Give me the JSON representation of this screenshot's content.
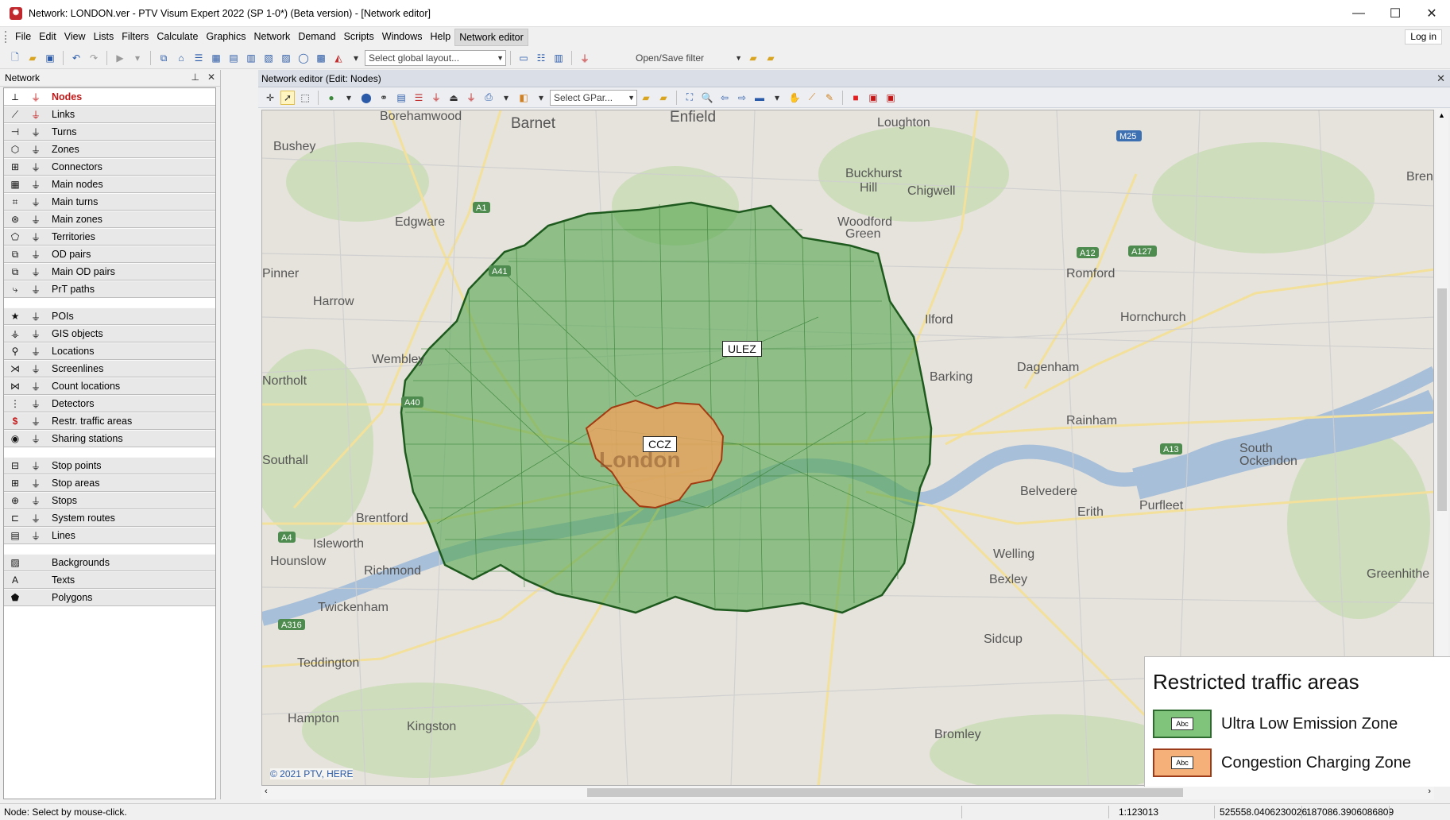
{
  "window": {
    "title": "Network: LONDON.ver - PTV Visum Expert 2022 (SP 1-0*) (Beta version) - [Network editor]",
    "minimize": "—",
    "maximize": "☐",
    "close": "✕"
  },
  "menu": {
    "items": [
      "File",
      "Edit",
      "View",
      "Lists",
      "Filters",
      "Calculate",
      "Graphics",
      "Network",
      "Demand",
      "Scripts",
      "Windows",
      "Help",
      "Network editor"
    ],
    "login": "Log in"
  },
  "toolbar": {
    "layout_placeholder": "Select global layout...",
    "filter_label": "Open/Save filter"
  },
  "network_panel": {
    "title": "Network",
    "groups": [
      [
        {
          "label": "Nodes",
          "icon": "node-icon",
          "selected": true
        },
        {
          "label": "Links",
          "icon": "link-icon"
        },
        {
          "label": "Turns",
          "icon": "turn-icon"
        },
        {
          "label": "Zones",
          "icon": "zone-icon"
        },
        {
          "label": "Connectors",
          "icon": "connector-icon"
        },
        {
          "label": "Main nodes",
          "icon": "main-node-icon"
        },
        {
          "label": "Main turns",
          "icon": "main-turn-icon"
        },
        {
          "label": "Main zones",
          "icon": "main-zone-icon"
        },
        {
          "label": "Territories",
          "icon": "territory-icon"
        },
        {
          "label": "OD pairs",
          "icon": "od-pair-icon"
        },
        {
          "label": "Main OD pairs",
          "icon": "main-od-pair-icon"
        },
        {
          "label": "PrT paths",
          "icon": "prt-path-icon"
        }
      ],
      [
        {
          "label": "POIs",
          "icon": "poi-icon"
        },
        {
          "label": "GIS objects",
          "icon": "gis-object-icon"
        },
        {
          "label": "Locations",
          "icon": "location-icon"
        },
        {
          "label": "Screenlines",
          "icon": "screenline-icon"
        },
        {
          "label": "Count locations",
          "icon": "count-location-icon"
        },
        {
          "label": "Detectors",
          "icon": "detector-icon"
        },
        {
          "label": "Restr. traffic areas",
          "icon": "restricted-area-icon"
        },
        {
          "label": "Sharing stations",
          "icon": "sharing-station-icon"
        }
      ],
      [
        {
          "label": "Stop points",
          "icon": "stop-point-icon"
        },
        {
          "label": "Stop areas",
          "icon": "stop-area-icon"
        },
        {
          "label": "Stops",
          "icon": "stop-icon"
        },
        {
          "label": "System routes",
          "icon": "system-route-icon"
        },
        {
          "label": "Lines",
          "icon": "line-icon"
        }
      ],
      [
        {
          "label": "Backgrounds",
          "icon": "background-icon",
          "nofilter": true
        },
        {
          "label": "Texts",
          "icon": "text-icon",
          "nofilter": true
        },
        {
          "label": "Polygons",
          "icon": "polygon-icon",
          "nofilter": true
        }
      ]
    ]
  },
  "editor": {
    "title": "Network editor (Edit: Nodes)",
    "gpar_placeholder": "Select GPar..."
  },
  "map": {
    "copyright": "© 2021 PTV, HERE",
    "ulez_label": "ULEZ",
    "ccz_label": "CCZ",
    "city_label": "London",
    "places": [
      {
        "name": "Borehamwood"
      },
      {
        "name": "Barnet"
      },
      {
        "name": "Enfield"
      },
      {
        "name": "Loughton"
      },
      {
        "name": "Bushey"
      },
      {
        "name": "Buckhurst"
      },
      {
        "name": "Hill"
      },
      {
        "name": "Chigwell"
      },
      {
        "name": "Edgware"
      },
      {
        "name": "Woodford"
      },
      {
        "name": "Green"
      },
      {
        "name": "Romford"
      },
      {
        "name": "Harrow"
      },
      {
        "name": "Ilford"
      },
      {
        "name": "Hornchurch"
      },
      {
        "name": "Wembley"
      },
      {
        "name": "Dagenham"
      },
      {
        "name": "Northolt"
      },
      {
        "name": "Barking"
      },
      {
        "name": "Rainham"
      },
      {
        "name": "Southall"
      },
      {
        "name": "South"
      },
      {
        "name": "Ockendon"
      },
      {
        "name": "Brentford"
      },
      {
        "name": "Belvedere"
      },
      {
        "name": "Purfleet"
      },
      {
        "name": "Isleworth"
      },
      {
        "name": "Erith"
      },
      {
        "name": "Hounslow"
      },
      {
        "name": "Richmond"
      },
      {
        "name": "Welling"
      },
      {
        "name": "Twickenham"
      },
      {
        "name": "Bexley"
      },
      {
        "name": "Greenhithe"
      },
      {
        "name": "Teddington"
      },
      {
        "name": "Sidcup"
      },
      {
        "name": "Hampton"
      },
      {
        "name": "Kingston"
      },
      {
        "name": "Bromley"
      },
      {
        "name": "Brentw"
      },
      {
        "name": "Pinner"
      }
    ],
    "roads": [
      {
        "name": "A1"
      },
      {
        "name": "A41"
      },
      {
        "name": "A40"
      },
      {
        "name": "A4"
      },
      {
        "name": "A316"
      },
      {
        "name": "A12"
      },
      {
        "name": "A127"
      },
      {
        "name": "A13"
      },
      {
        "name": "M25"
      }
    ]
  },
  "legend": {
    "title": "Restricted traffic areas",
    "swatch_text": "Abc",
    "items": [
      {
        "label": "Ultra Low Emission Zone",
        "fill": "#7fc47a",
        "border": "#2e6b2e"
      },
      {
        "label": "Congestion Charging Zone",
        "fill": "#f5b07a",
        "border": "#9b3b1a"
      }
    ]
  },
  "status": {
    "message": "Node: Select by mouse-click.",
    "scale": "1:123013",
    "x": "525558.0406230026",
    "y": "187086.3906086809"
  },
  "colors": {
    "ulez_fill": "#55a64f",
    "ulez_border": "#1e5a1e",
    "ccz_fill": "#e8a561",
    "ccz_border": "#a23a12",
    "accent": "#c01818"
  }
}
